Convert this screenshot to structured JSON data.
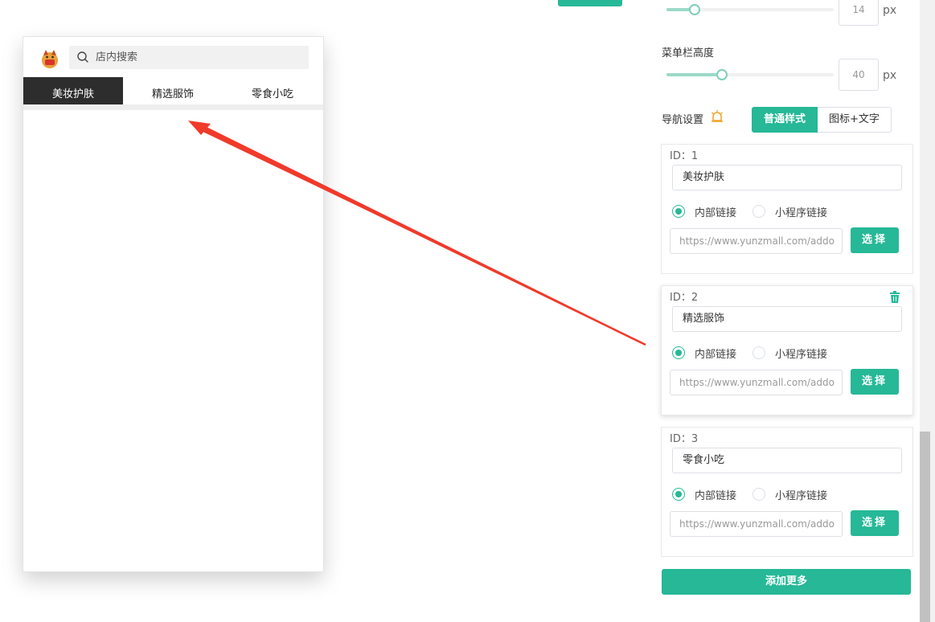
{
  "phone": {
    "search_placeholder": "店内搜索",
    "tabs": [
      {
        "label": "美妆护肤",
        "active": true
      },
      {
        "label": "精选服饰",
        "active": false
      },
      {
        "label": "零食小吃",
        "active": false
      }
    ]
  },
  "settings": {
    "font_size": {
      "value": "14",
      "unit": "px",
      "level": 0.17
    },
    "menu_height": {
      "label": "菜单栏高度",
      "value": "40",
      "unit": "px",
      "level": 0.34
    },
    "nav": {
      "label": "导航设置",
      "style_options": [
        "普通样式",
        "图标+文字"
      ],
      "selected_style": "普通样式"
    },
    "items": [
      {
        "id_label": "ID：",
        "id": "1",
        "name": "美妆护肤",
        "link_type_internal": "内部链接",
        "link_type_miniprogram": "小程序链接",
        "selected_link_type": "内部链接",
        "url": "https://www.yunzmall.com/addo",
        "select_label": "选择"
      },
      {
        "id_label": "ID：",
        "id": "2",
        "name": "精选服饰",
        "link_type_internal": "内部链接",
        "link_type_miniprogram": "小程序链接",
        "selected_link_type": "内部链接",
        "url": "https://www.yunzmall.com/addo",
        "select_label": "选择"
      },
      {
        "id_label": "ID：",
        "id": "3",
        "name": "零食小吃",
        "link_type_internal": "内部链接",
        "link_type_miniprogram": "小程序链接",
        "selected_link_type": "内部链接",
        "url": "https://www.yunzmall.com/addo",
        "select_label": "选择"
      }
    ],
    "add_more_label": "添加更多"
  },
  "colors": {
    "accent": "#26b897",
    "annotation_arrow": "#f03a2a",
    "active_tab_bg": "#2d2d2d",
    "hint_icon": "#f0a020"
  }
}
